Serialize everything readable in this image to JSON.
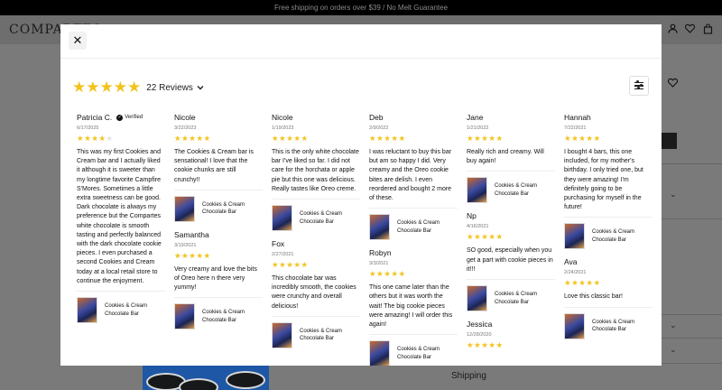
{
  "announcement": "Free shipping on orders over $39 / No Melt Guarantee",
  "brand_logo": "COMPARTES",
  "background_accordion": {
    "shipping_label": "Shipping"
  },
  "modal": {
    "close_label": "✕",
    "rating_stars": 5,
    "review_count_label": "22 Reviews",
    "filter_label": "Filter"
  },
  "colors": {
    "star": "#f2c31c",
    "overlay": "#7a7a7a"
  },
  "product_name": "Cookies & Cream Chocolate Bar",
  "columns": [
    [
      {
        "name": "Patricia C.",
        "verified": "Verified",
        "date": "6/17/2025",
        "stars": 4,
        "stars_str": "★★★★",
        "empty_str": "★",
        "text": "This was my first Cookies and Cream bar and I actually liked it although it is sweeter than my longtime favorite Campfire S'Mores. Sometimes a little extra sweetness can be good. Dark chocolate is always my preference but the Compartes white chocolate is smooth tasting and  perfectly balanced with the dark chocolate cookie pieces. I even purchased a second Cookies and Cream today at a local retail store to continue the enjoyment.",
        "product": "Cookies & Cream Chocolate Bar"
      }
    ],
    [
      {
        "name": "Nicole",
        "date": "3/22/2023",
        "stars": 5,
        "stars_str": "★★★★★",
        "empty_str": "",
        "text": "The Cookies & Cream bar is sensational! I love that the cookie chunks are still crunchy!!",
        "product": "Cookies & Cream Chocolate Bar"
      },
      {
        "name": "Samantha",
        "date": "3/19/2021",
        "stars": 5,
        "stars_str": "★★★★★",
        "empty_str": "",
        "text": "Very creamy and love the bits of Oreo here n there very yummy!",
        "product": "Cookies & Cream Chocolate Bar"
      }
    ],
    [
      {
        "name": "Nicole",
        "date": "1/19/2023",
        "stars": 5,
        "stars_str": "★★★★★",
        "empty_str": "",
        "text": "This is the only white chocolate bar I've liked so far. I did not care for the horchata or apple pie but this one was delicious. Really tastes like Oreo creme.",
        "product": "Cookies & Cream Chocolate Bar"
      },
      {
        "name": "Fox",
        "date": "2/27/2021",
        "stars": 5,
        "stars_str": "★★★★★",
        "empty_str": "",
        "text": "This chocolate bar was incredibly smooth, the cookies were crunchy and overall delicious!",
        "product": "Cookies & Cream Chocolate Bar"
      }
    ],
    [
      {
        "name": "Deb",
        "date": "2/9/2022",
        "stars": 5,
        "stars_str": "★★★★★",
        "empty_str": "",
        "text": "I was reluctant to buy this bar but am so happy I did. Very creamy and the Oreo cookie bites are delish. I even reordered and bought 2 more of these.",
        "product": "Cookies & Cream Chocolate Bar"
      },
      {
        "name": "Robyn",
        "date": "3/3/2021",
        "stars": 5,
        "stars_str": "★★★★★",
        "empty_str": "",
        "text": "This one came later than the others but it was worth the wait! The big cookie pieces were amazing! I will order this again!",
        "product": "Cookies & Cream Chocolate Bar"
      }
    ],
    [
      {
        "name": "Jane",
        "date": "1/21/2022",
        "stars": 5,
        "stars_str": "★★★★★",
        "empty_str": "",
        "text": "Really rich and creamy. Will buy again!",
        "product": "Cookies & Cream Chocolate Bar"
      },
      {
        "name": "Np",
        "date": "4/16/2021",
        "stars": 5,
        "stars_str": "★★★★★",
        "empty_str": "",
        "text": "SO good, especially when you get a part with cookie pieces in it!!!",
        "product": "Cookies & Cream Chocolate Bar"
      },
      {
        "name": "Jessica",
        "date": "12/28/2020",
        "stars": 5,
        "stars_str": "★★★★★",
        "empty_str": "",
        "text": "",
        "product": ""
      }
    ],
    [
      {
        "name": "Hannah",
        "date": "7/22/2021",
        "stars": 5,
        "stars_str": "★★★★★",
        "empty_str": "",
        "text": "I bought 4 bars, this one included, for my mother's birthday. I only tried one, but they were amazing! I'm definitely going to be purchasing for myself in the future!",
        "product": "Cookies & Cream Chocolate Bar"
      },
      {
        "name": "Ava",
        "date": "2/24/2021",
        "stars": 5,
        "stars_str": "★★★★★",
        "empty_str": "",
        "text": "Love this classic bar!",
        "product": "Cookies & Cream Chocolate Bar"
      }
    ]
  ]
}
